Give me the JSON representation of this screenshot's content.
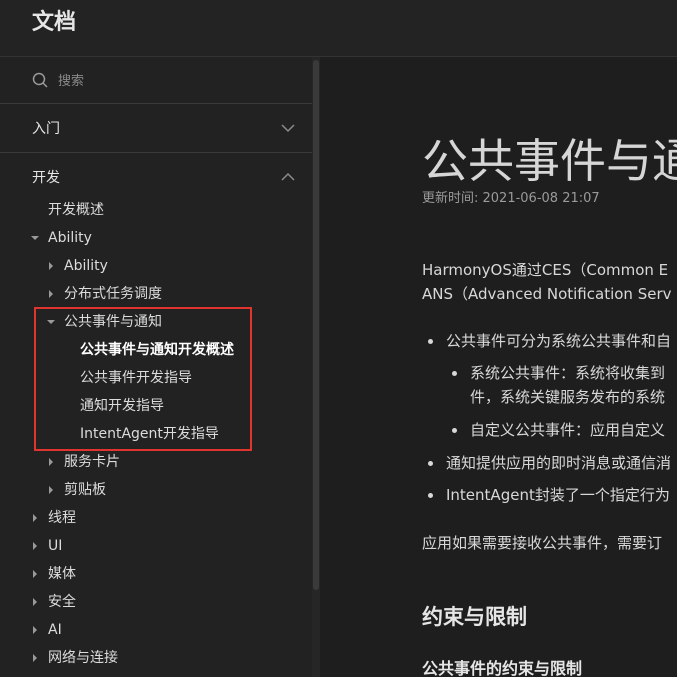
{
  "header": {
    "title": "文档"
  },
  "search": {
    "placeholder": "搜索"
  },
  "sidebar": {
    "sections": [
      {
        "label": "入门",
        "expanded": false
      },
      {
        "label": "开发",
        "expanded": true
      }
    ],
    "items": [
      "开发概述",
      "Ability",
      "Ability",
      "分布式任务调度",
      "公共事件与通知",
      "公共事件与通知开发概述",
      "公共事件开发指导",
      "通知开发指导",
      "IntentAgent开发指导",
      "服务卡片",
      "剪贴板",
      "线程",
      "UI",
      "媒体",
      "安全",
      "AI",
      "网络与连接"
    ]
  },
  "content": {
    "title": "公共事件与通",
    "update_time": "更新时间: 2021-06-08 21:07",
    "intro_line1": "HarmonyOS通过CES（Common E",
    "intro_line2": "ANS（Advanced Notification Serv",
    "bullets": [
      "公共事件可分为系统公共事件和自",
      "系统公共事件：系统将收集到",
      "件，系统关键服务发布的系统",
      "自定义公共事件：应用自定义",
      "通知提供应用的即时消息或通信消",
      "IntentAgent封装了一个指定行为"
    ],
    "para2": "应用如果需要接收公共事件，需要订",
    "h2": "约束与限制",
    "h3": "公共事件的约束与限制"
  }
}
